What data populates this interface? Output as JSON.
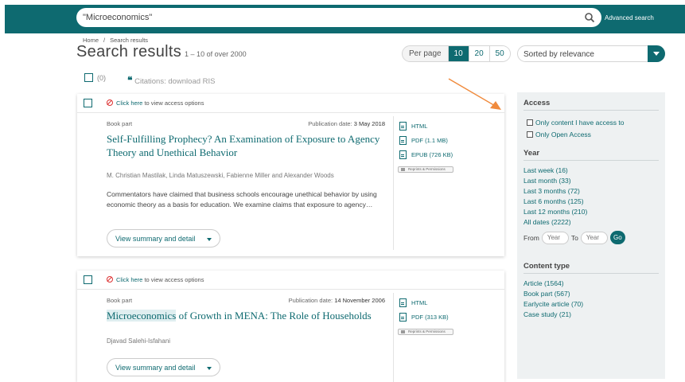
{
  "search": {
    "value": "\"Microeconomics\"",
    "advanced_label": "Advanced search"
  },
  "breadcrumb": {
    "home": "Home",
    "sep": "/",
    "current": "Search results"
  },
  "heading": {
    "title": "Search results",
    "subtitle": "1 – 10 of over 2000"
  },
  "per_page": {
    "label": "Per page",
    "options": [
      "10",
      "20",
      "50"
    ],
    "selected": "10"
  },
  "sort": {
    "value": "Sorted by relevance"
  },
  "selection": {
    "count": "(0)",
    "citations_label": "Citations: download RIS"
  },
  "results": [
    {
      "access_link": "Click here",
      "access_text": "to view access options",
      "type": "Book part",
      "pub_label": "Publication date:",
      "pub_date": "3 May 2018",
      "title": "Self-Fulfilling Prophecy? An Examination of Exposure to Agency Theory and Unethical Behavior",
      "authors": "M. Christian Mastilak, Linda Matuszewski, Fabienne Miller and Alexander Woods",
      "abstract": "Commentators have claimed that business schools encourage unethical behavior by using economic theory as a basis for education. We examine claims that exposure to agency…",
      "formats": [
        "HTML",
        "PDF (1.1 MB)",
        "EPUB (726 KB)"
      ],
      "reprints": "Reprints & Permissions",
      "summary_button": "View summary and detail"
    },
    {
      "access_link": "Click here",
      "access_text": "to view access options",
      "type": "Book part",
      "pub_label": "Publication date:",
      "pub_date": "14 November 2006",
      "title_highlight": "Microeconomics",
      "title_rest": " of Growth in MENA: The Role of Households",
      "authors": "Djavad Salehi-Isfahani",
      "formats": [
        "HTML",
        "PDF (313 KB)"
      ],
      "reprints": "Reprints & Permissions",
      "summary_button": "View summary and detail"
    }
  ],
  "sidebar": {
    "access_heading": "Access",
    "access_options": [
      "Only content I have access to",
      "Only Open Access"
    ],
    "year_heading": "Year",
    "year_links": [
      "Last week (16)",
      "Last month (33)",
      "Last 3 months (72)",
      "Last 6 months (125)",
      "Last 12 months (210)",
      "All dates (2222)"
    ],
    "from_label": "From",
    "to_label": "To",
    "year_placeholder": "Year",
    "go_label": "Go",
    "content_heading": "Content type",
    "content_links": [
      "Article (1564)",
      "Book part (567)",
      "Earlycite article (70)",
      "Case study (21)"
    ]
  },
  "colors": {
    "brand": "#0e6a70",
    "annotation_arrow": "#f08a3c",
    "sidebar_bg": "#eef1f2"
  }
}
